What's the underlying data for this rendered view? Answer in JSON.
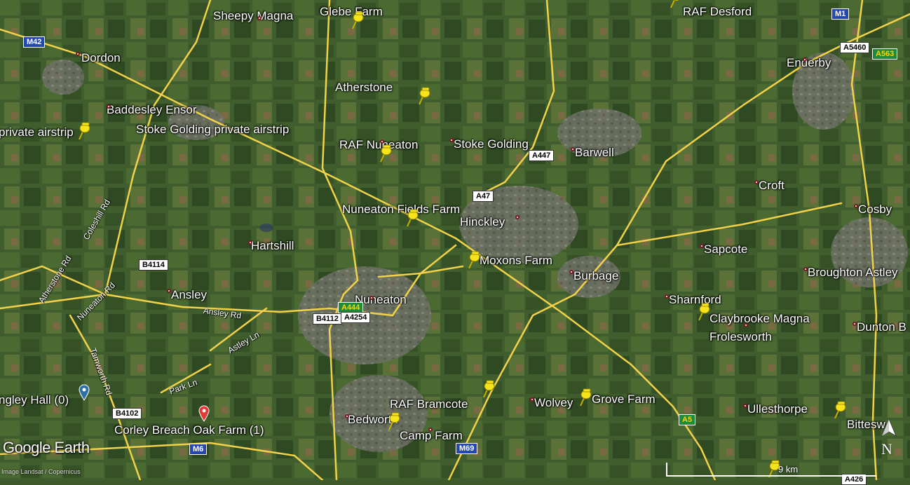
{
  "places": [
    {
      "name": "Sheepy Magna",
      "dot": true
    },
    {
      "name": "Glebe Farm",
      "dot": false
    },
    {
      "name": "RAF Desford",
      "dot": false
    },
    {
      "name": "Dordon",
      "dot": true
    },
    {
      "name": "Enderby",
      "dot": true
    },
    {
      "name": "Baddesley Ensor",
      "dot": true
    },
    {
      "name": "Stoke Golding private airstrip",
      "dot": false
    },
    {
      "name": "Atherstone",
      "dot": true
    },
    {
      "name": "private airstrip",
      "dot": false
    },
    {
      "name": "RAF Nuneaton",
      "dot": true
    },
    {
      "name": "Stoke Golding",
      "dot": true
    },
    {
      "name": "Barwell",
      "dot": true
    },
    {
      "name": "Croft",
      "dot": true
    },
    {
      "name": "Cosby",
      "dot": true
    },
    {
      "name": "Nuneaton Fields Farm",
      "dot": false
    },
    {
      "name": "Hinckley",
      "dot": true
    },
    {
      "name": "Hartshill",
      "dot": true
    },
    {
      "name": "Sapcote",
      "dot": true
    },
    {
      "name": "Moxons Farm",
      "dot": false
    },
    {
      "name": "Burbage",
      "dot": true
    },
    {
      "name": "Broughton Astley",
      "dot": true
    },
    {
      "name": "Ansley",
      "dot": true
    },
    {
      "name": "Nuneaton",
      "dot": true
    },
    {
      "name": "Sharnford",
      "dot": true
    },
    {
      "name": "Claybrooke Magna",
      "dot": true
    },
    {
      "name": "Frolesworth",
      "dot": false
    },
    {
      "name": "Dunton B",
      "dot": true
    },
    {
      "name": "ngley Hall (0)",
      "dot": false
    },
    {
      "name": "RAF Bramcote",
      "dot": false
    },
    {
      "name": "Wolvey",
      "dot": true
    },
    {
      "name": "Grove Farm",
      "dot": false
    },
    {
      "name": "Ullesthorpe",
      "dot": true
    },
    {
      "name": "Bedworth",
      "dot": true
    },
    {
      "name": "Corley Breach Oak Farm (1)",
      "dot": false
    },
    {
      "name": "Camp Farm",
      "dot": true
    },
    {
      "name": "Bittesw",
      "dot": false
    }
  ],
  "road_shields": [
    {
      "ref": "M42",
      "kind": "mw"
    },
    {
      "ref": "M1",
      "kind": "mw"
    },
    {
      "ref": "A5460",
      "kind": "a"
    },
    {
      "ref": "A563",
      "kind": "pr"
    },
    {
      "ref": "A447",
      "kind": "a"
    },
    {
      "ref": "A47",
      "kind": "a"
    },
    {
      "ref": "B4114",
      "kind": "a"
    },
    {
      "ref": "A444",
      "kind": "pr"
    },
    {
      "ref": "B4112",
      "kind": "a"
    },
    {
      "ref": "A4254",
      "kind": "a"
    },
    {
      "ref": "B4102",
      "kind": "a"
    },
    {
      "ref": "M6",
      "kind": "mw"
    },
    {
      "ref": "M69",
      "kind": "mw"
    },
    {
      "ref": "A5",
      "kind": "pr"
    },
    {
      "ref": "A426",
      "kind": "a"
    }
  ],
  "road_names": [
    "Coleshill Rd",
    "Atherstone Rd",
    "Nuneaton Rd",
    "Tamworth Rd",
    "Ansley Rd",
    "Astley Ln",
    "Park Ln"
  ],
  "branding": {
    "logo": "Google Earth",
    "attribution": "Image Landsat / Copernicus"
  },
  "scale": {
    "label": "9 km"
  },
  "compass": {
    "label": "N"
  },
  "colors": {
    "pin": "#f5e31c",
    "road": "#f1d24a",
    "label": "#ffffff",
    "place_dot_ring": "#7a1a22",
    "red_pin": "#e53935",
    "blue_pin": "#2f6fa8"
  }
}
